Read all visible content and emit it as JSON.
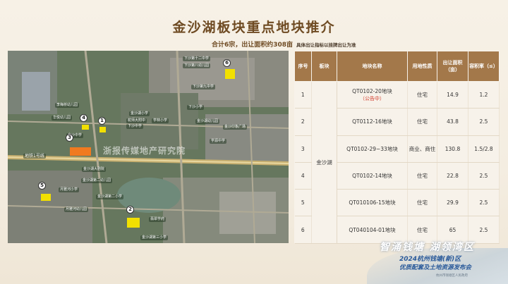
{
  "page_title": "金沙湖板块重点地块推介",
  "summary": "合计6宗，出让面积约308亩",
  "note": "具体出让指标以挂牌出让为准",
  "map": {
    "watermark": "浙报传媒地产研究院",
    "labels": [
      {
        "text": "下沙第十二中学",
        "name": "label-school-12"
      },
      {
        "text": "下沙第八幼儿园",
        "name": "label-kinder-8"
      },
      {
        "text": "下沙第九中学",
        "name": "label-school-9"
      },
      {
        "text": "下沙中学",
        "name": "label-xiasha-middle"
      },
      {
        "text": "下沙小学",
        "name": "label-xiasha-primary"
      },
      {
        "text": "李梅桥幼儿园",
        "name": "label-limeiqiao-kinder"
      },
      {
        "text": "华悦幼儿园",
        "name": "label-huayue-kinder"
      },
      {
        "text": "金沙湖小学",
        "name": "label-jinshahu-primary"
      },
      {
        "text": "杭师大附中",
        "name": "label-hangshida-high"
      },
      {
        "text": "学林小学",
        "name": "label-xuelin-primary"
      },
      {
        "text": "金沙中学",
        "name": "label-jinsha-middle"
      },
      {
        "text": "学源中学",
        "name": "label-xueyuan-middle"
      },
      {
        "text": "金沙湖幼儿园",
        "name": "label-jinshahu-kinder"
      },
      {
        "text": "金沙印象广场",
        "name": "label-jinsha-plaza"
      },
      {
        "text": "地铁1号线",
        "name": "label-metro-1"
      },
      {
        "text": "金沙湖大剧院",
        "name": "label-theatre"
      },
      {
        "text": "金沙湖第二幼儿园",
        "name": "label-kinder-2"
      },
      {
        "text": "金沙湖第二小学",
        "name": "label-primary-2"
      },
      {
        "text": "月雅河幼儿园",
        "name": "label-yueyahe-kinder"
      },
      {
        "text": "月雅河小学",
        "name": "label-yueyahe-primary"
      },
      {
        "text": "翡翠学府",
        "name": "label-feicui"
      },
      {
        "text": "金沙湖第三小学",
        "name": "label-primary-3"
      }
    ],
    "markers": [
      "1",
      "2",
      "3",
      "4",
      "5",
      "6"
    ]
  },
  "table": {
    "headers": [
      "序号",
      "板块",
      "地块名称",
      "用地性质",
      "出让面积（亩）",
      "容积率（≤）"
    ],
    "block": "金沙湖",
    "rows": [
      {
        "no": "1",
        "name": "QT0102-20地块",
        "status": "（公告中）",
        "use": "住宅",
        "area": "14.9",
        "far": "1.2"
      },
      {
        "no": "2",
        "name": "QT0112-16地块",
        "status": "",
        "use": "住宅",
        "area": "43.8",
        "far": "2.5"
      },
      {
        "no": "3",
        "name": "QT0102-29~33地块",
        "status": "",
        "use": "商业、商住",
        "area": "130.8",
        "far": "1.5/2.8"
      },
      {
        "no": "4",
        "name": "QT0102-14地块",
        "status": "",
        "use": "住宅",
        "area": "22.8",
        "far": "2.5"
      },
      {
        "no": "5",
        "name": "QT010106-15地块",
        "status": "",
        "use": "住宅",
        "area": "29.9",
        "far": "2.5"
      },
      {
        "no": "6",
        "name": "QT040104-01地块",
        "status": "",
        "use": "住宅",
        "area": "65",
        "far": "2.5"
      }
    ]
  },
  "slogan": "智涌钱塘 湖领湾区",
  "conference_line1": "2024杭州钱塘(新)区",
  "conference_line2": "优质配套及土地资源发布会",
  "issuer": "杭州市钱塘区人民政府"
}
